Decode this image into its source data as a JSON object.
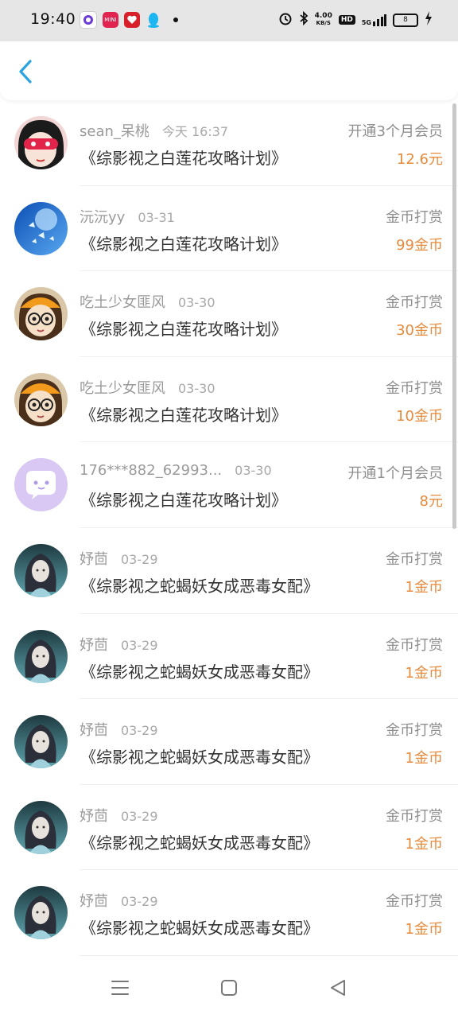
{
  "status_bar": {
    "time": "19:40",
    "net_speed_value": "4.00",
    "net_speed_unit": "KB/S",
    "hd": "HD",
    "signal": "5G",
    "battery": "8",
    "app_icon_label": "MINI"
  },
  "items": [
    {
      "name": "sean_呆桃",
      "date": "今天 16:37",
      "title": "《综影视之白莲花攻略计划》",
      "type": "开通3个月会员",
      "amount": "12.6元",
      "avatar": "cartoon-girl-red-mask"
    },
    {
      "name": "沅沅yy",
      "date": "03-31",
      "title": "《综影视之白莲花攻略计划》",
      "type": "金币打赏",
      "amount": "99金币",
      "avatar": "blue-butterflies"
    },
    {
      "name": "吃土少女匪风",
      "date": "03-30",
      "title": "《综影视之白莲花攻略计划》",
      "type": "金币打赏",
      "amount": "30金币",
      "avatar": "cartoon-girl-orange-hat"
    },
    {
      "name": "吃土少女匪风",
      "date": "03-30",
      "title": "《综影视之白莲花攻略计划》",
      "type": "金币打赏",
      "amount": "10金币",
      "avatar": "cartoon-girl-orange-hat"
    },
    {
      "name": "176***882_62993...",
      "date": "03-30",
      "title": "《综影视之白莲花攻略计划》",
      "type": "开通1个月会员",
      "amount": "8元",
      "avatar": "default-chat-bubble"
    },
    {
      "name": "妤茴",
      "date": "03-29",
      "title": "《综影视之蛇蝎妖女成恶毒女配》",
      "type": "金币打赏",
      "amount": "1金币",
      "avatar": "fantasy-girl"
    },
    {
      "name": "妤茴",
      "date": "03-29",
      "title": "《综影视之蛇蝎妖女成恶毒女配》",
      "type": "金币打赏",
      "amount": "1金币",
      "avatar": "fantasy-girl"
    },
    {
      "name": "妤茴",
      "date": "03-29",
      "title": "《综影视之蛇蝎妖女成恶毒女配》",
      "type": "金币打赏",
      "amount": "1金币",
      "avatar": "fantasy-girl"
    },
    {
      "name": "妤茴",
      "date": "03-29",
      "title": "《综影视之蛇蝎妖女成恶毒女配》",
      "type": "金币打赏",
      "amount": "1金币",
      "avatar": "fantasy-girl"
    },
    {
      "name": "妤茴",
      "date": "03-29",
      "title": "《综影视之蛇蝎妖女成恶毒女配》",
      "type": "金币打赏",
      "amount": "1金币",
      "avatar": "fantasy-girl"
    }
  ],
  "colors": {
    "accent_back": "#2aa3e0",
    "amount": "#e88a3c",
    "name": "#9a9a9a",
    "title": "#333333"
  },
  "icons": {
    "back": "chevron-left-icon",
    "menu": "menu-icon",
    "home": "home-square-icon",
    "back_nav": "triangle-back-icon"
  }
}
